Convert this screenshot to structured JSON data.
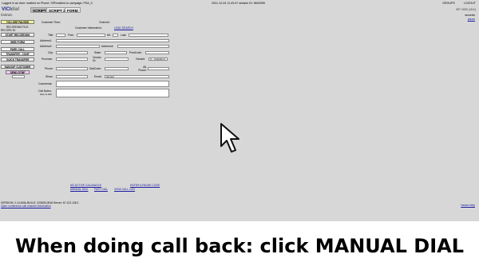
{
  "top": {
    "left_text": "Logged in as User: realtest on Phone: SIP/realtest to campaign: PSA_C",
    "center_text": "2021-12-04 11:43:47   session ID: 8600055",
    "right_links": [
      "GROUPS",
      "LOGOUT"
    ]
  },
  "nav": {
    "logo_main": "VICI",
    "logo_sub": "dial",
    "tabs": [
      "SCRIPT",
      "SCRIPT 2",
      "FORM"
    ],
    "right_text": "SIP: 0000 (1111)"
  },
  "status": {
    "label": "STATUS:",
    "right_line1": "seconds",
    "right_link": "pause"
  },
  "left_panel": {
    "paused_button": "YOU ARE PAUSED",
    "recording_file": "RECORDING FILE:",
    "recording_id": "RECORD ID:",
    "buttons": [
      "START RECORDING",
      "WEB FORM",
      "PARK CALL",
      "TRANSFER - CONF",
      "QUICK TRANSFER",
      "HANGUP CUSTOMER"
    ],
    "send_button": "SEND DTMF"
  },
  "customer": {
    "customer_time": "Customer Time:",
    "channel": "Channel:",
    "customer_information": "Customer Information:",
    "lead_search": "LEAD SEARCH",
    "fields": {
      "title": "Title:",
      "first": "First:",
      "mi": "MI:",
      "last": "Last:",
      "address1": "Address1:",
      "address2": "Address2:",
      "address3": "Address3:",
      "city": "City:",
      "state": "State:",
      "postcode": "PostCode:",
      "province": "Province:",
      "vendor_id": "Vendor ID:",
      "gender": "Gender:",
      "gender_value": "U - Undefined",
      "phone": "Phone:",
      "dialcode": "DialCode:",
      "alt_phone": "Alt. Phone:",
      "show": "Show:",
      "email": "Email:",
      "email_value": "tamtest",
      "comments": "Comments:",
      "call_notes": "Call Notes:",
      "call_notes_sub": "Here to Add"
    }
  },
  "bottom_links": {
    "no_active": "NO ACTIVE CALLBACKS",
    "enter_pause": "ENTER A PAUSE CODE",
    "manual_dial": "MANUAL DIAL",
    "fast_dial": "FAST DIAL",
    "view_call_log": "VIEW CALL LOG"
  },
  "footer": {
    "version": "VERSION: 2.14-603c   BUILD: 220625-0818     Server: 67.122.128.1",
    "link": "Open conference call channel information",
    "right_link": "Needs Help"
  },
  "caption": "When doing call back: click MANUAL DIAL",
  "icons": {
    "cursor": "mouse-pointer-icon"
  },
  "colors": {
    "background": "#d7d7d7",
    "paused": "#f3f395",
    "send": "#f1c8f3",
    "link": "#1a1aa0"
  }
}
